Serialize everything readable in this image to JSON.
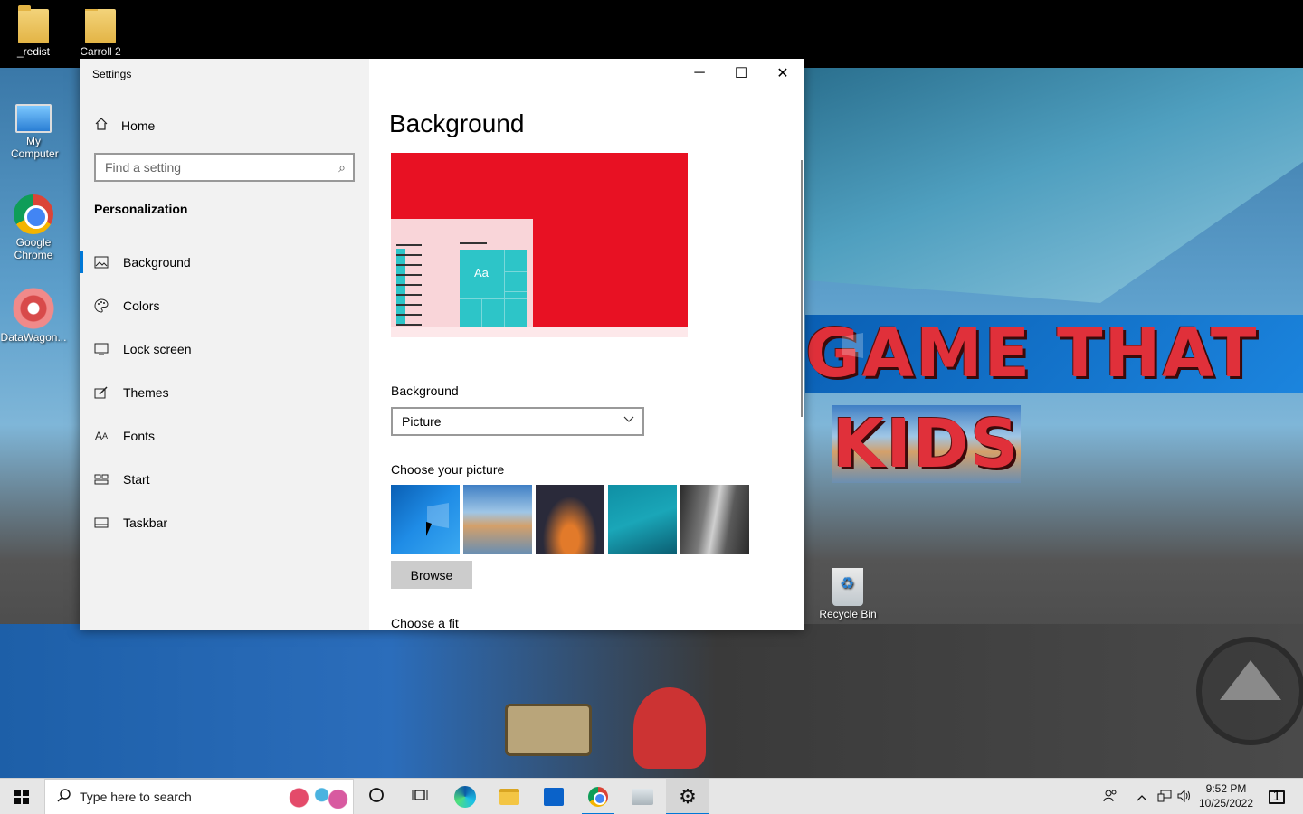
{
  "desktop": {
    "icons": [
      {
        "label": "_redist"
      },
      {
        "label": "Carroll 2"
      },
      {
        "label": "My Computer"
      },
      {
        "label": "Google Chrome"
      },
      {
        "label": "DataWagon..."
      },
      {
        "label": "Recycle Bin"
      }
    ],
    "wallpaper_text": [
      "GAME THAT",
      "KIDS"
    ]
  },
  "window": {
    "title": "Settings",
    "controls": {
      "minimize": "─",
      "maximize": "☐",
      "close": "✕"
    }
  },
  "sidebar": {
    "home_label": "Home",
    "search_placeholder": "Find a setting",
    "section_title": "Personalization",
    "items": [
      {
        "label": "Background",
        "icon": "picture-icon",
        "active": true
      },
      {
        "label": "Colors",
        "icon": "palette-icon",
        "active": false
      },
      {
        "label": "Lock screen",
        "icon": "lock-screen-icon",
        "active": false
      },
      {
        "label": "Themes",
        "icon": "themes-icon",
        "active": false
      },
      {
        "label": "Fonts",
        "icon": "fonts-icon",
        "active": false
      },
      {
        "label": "Start",
        "icon": "start-icon",
        "active": false
      },
      {
        "label": "Taskbar",
        "icon": "taskbar-icon",
        "active": false
      }
    ]
  },
  "main": {
    "page_title": "Background",
    "preview": {
      "tile_text": "Aa",
      "accent_color": "#e81123",
      "tile_color": "#2dc5c8"
    },
    "background_label": "Background",
    "background_value": "Picture",
    "choose_picture_label": "Choose your picture",
    "browse_label": "Browse",
    "choose_fit_label": "Choose a fit"
  },
  "taskbar": {
    "search_placeholder": "Type here to search",
    "clock_time": "9:52 PM",
    "clock_date": "10/25/2022",
    "notification_count": "1",
    "accent": "#0078d7"
  }
}
